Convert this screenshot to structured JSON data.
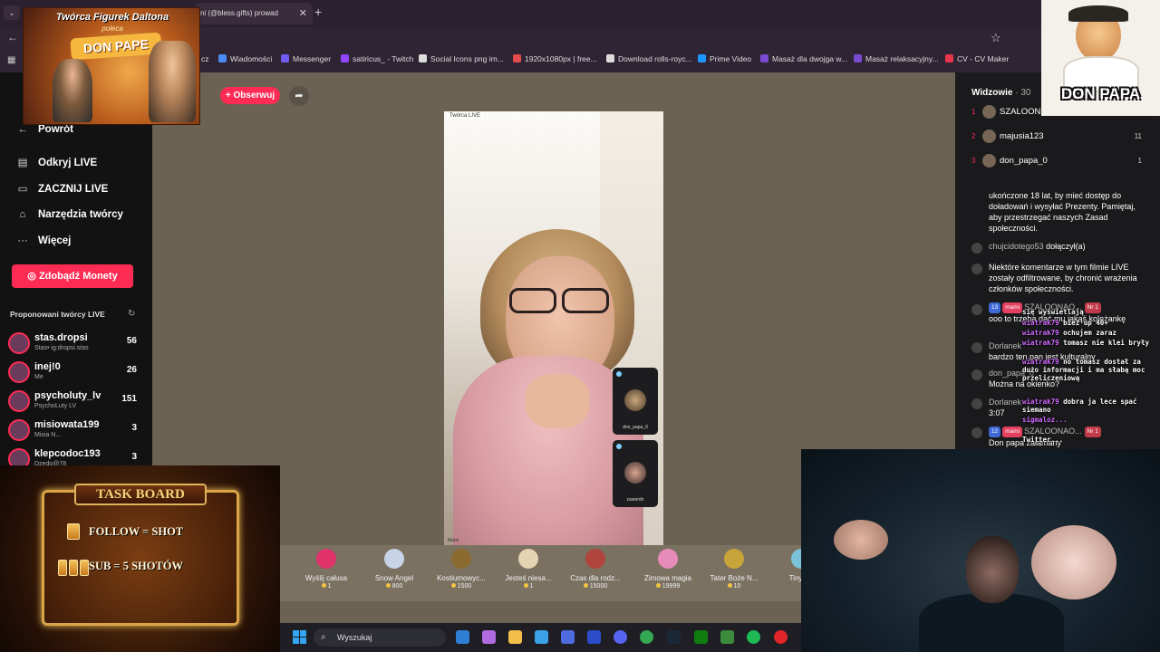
{
  "browser": {
    "tab_title": "ni (@bless.gifts) prowad",
    "bookmarks": [
      "cz",
      "Wiadomości",
      "Messenger",
      "satiricus_ - Twitch",
      "Social Icons png im...",
      "1920x1080px | free...",
      "Download rolls-royc...",
      "Prime Video",
      "Masaż dla dwojga w...",
      "Masaż relaksacyjny...",
      "CV - CV Maker"
    ],
    "bookmark_colors": [
      "#888888",
      "#4c8bf5",
      "#6f5cf5",
      "#9146ff",
      "#dddddd",
      "#e34c4c",
      "#dddddd",
      "#1a98ff",
      "#7a4bd0",
      "#7a4bd0",
      "#e8344c"
    ]
  },
  "overlay": {
    "logo_line1": "Twórca Figurek Daltona",
    "logo_line2": "poleca",
    "logo_brand": "DON PAPE",
    "donpapa_name": "DON PAPA",
    "taskboard_title": "TASK BOARD",
    "task1": "FOLLOW = SHOT",
    "task2": "SUB = 5 SHOTÓW"
  },
  "sidebar": {
    "back": "Powrót",
    "nav": [
      "Odkryj LIVE",
      "ZACZNIJ LIVE",
      "Narzędzia twórcy",
      "Więcej"
    ],
    "coins_button": "Zdobądź Monety",
    "suggested_title": "Proponowani twórcy LIVE",
    "creators": [
      {
        "name": "stas.dropsi",
        "sub": "Stas• ig:dropsi.stas",
        "count": "56"
      },
      {
        "name": "inej!0",
        "sub": "Me",
        "count": "26"
      },
      {
        "name": "psycholuty_lv",
        "sub": "PsychoLuty LV",
        "count": "151"
      },
      {
        "name": "misiowata199",
        "sub": "Misia N...",
        "count": "3"
      },
      {
        "name": "klepcodoc193",
        "sub": "Dzedo@78",
        "count": "3"
      }
    ]
  },
  "stream": {
    "follow_label": "+ Obserwuj",
    "video_label": "Twórca LIVE",
    "host_name": "Mami",
    "pip": [
      {
        "name": "don_papa_0"
      },
      {
        "name": "zawordn"
      }
    ]
  },
  "gifts": [
    {
      "name": "Wyślij całusa",
      "price": "1",
      "color": "#e0336b"
    },
    {
      "name": "Snow Angel",
      "price": "800",
      "color": "#c7d3e6"
    },
    {
      "name": "Kostiumowyc...",
      "price": "1500",
      "color": "#8b6a2f"
    },
    {
      "name": "Jesteś niesa...",
      "price": "1",
      "color": "#e6d3b3"
    },
    {
      "name": "Czas dla rodz...",
      "price": "15000",
      "color": "#b1443d"
    },
    {
      "name": "Zimowa magia",
      "price": "19999",
      "color": "#e78bb8"
    },
    {
      "name": "Tater Boże N...",
      "price": "10",
      "color": "#c9a43b"
    },
    {
      "name": "Tiny Bo",
      "price": "",
      "color": "#7bc3d9"
    }
  ],
  "right_panel": {
    "viewers_title": "Widzowie",
    "viewers_count": "· 30",
    "viewers": [
      {
        "rank": "1",
        "name": "SZALOON...",
        "count": ""
      },
      {
        "rank": "2",
        "name": "majusia123",
        "count": "11"
      },
      {
        "rank": "3",
        "name": "don_papa_0",
        "count": "1"
      }
    ],
    "messages": [
      {
        "user": "",
        "text": "ukończone 18 lat, by mieć dostęp do doładowań i wysyłać Prezenty. Pamiętaj, aby przestrzegać naszych Zasad społeczności."
      },
      {
        "user": "chujcidotego53",
        "text": "dołączył(a)"
      },
      {
        "user": "",
        "text": "Niektóre komentarze w tym filmie LIVE zostały odfiltrowane, by chronić wrażenia członków społeczności."
      },
      {
        "user": "SZALOONAO...",
        "text": "ooo to trzeba dać mu jakąś koleżankę"
      },
      {
        "user": "Dorlanek",
        "text": "bardzo ten pan jest kulturalny"
      },
      {
        "user": "don_papa_0",
        "text": "Można na okienko?"
      },
      {
        "user": "Dorlanek",
        "text": "3:07"
      },
      {
        "user": "SZALOONAO...",
        "text": "Don papa załamany"
      }
    ],
    "badges": [
      "13",
      "mami",
      "Nr 1",
      "12"
    ]
  },
  "overlay_chat": [
    {
      "user": "",
      "text": "się wyświetlają"
    },
    {
      "user": "wiatrak79",
      "text": "bież up 40+"
    },
    {
      "user": "wiatrak79",
      "text": "ochujem zaraz"
    },
    {
      "user": "wiatrak79",
      "text": "tomasz nie klei bryły"
    },
    {
      "user": "wiatrak79",
      "text": "no tomasz dostał za dużo informacji i ma słabą moc przeliczeniową"
    },
    {
      "user": "wiatrak79",
      "text": "dobra ja lece spać siemano"
    },
    {
      "user": "sigmaloz...",
      "text": ""
    },
    {
      "user": "",
      "text": "Twitter..."
    }
  ],
  "taskbar": {
    "search_placeholder": "Wyszukaj",
    "icons": [
      "windows-icon",
      "widgets-icon",
      "copilot-icon",
      "explorer-icon",
      "store-icon",
      "vpn-icon",
      "l-app-icon",
      "discord-icon",
      "chrome-icon",
      "steam-icon",
      "xbox-icon",
      "minecraft-icon",
      "spotify-icon",
      "opera-icon"
    ]
  }
}
